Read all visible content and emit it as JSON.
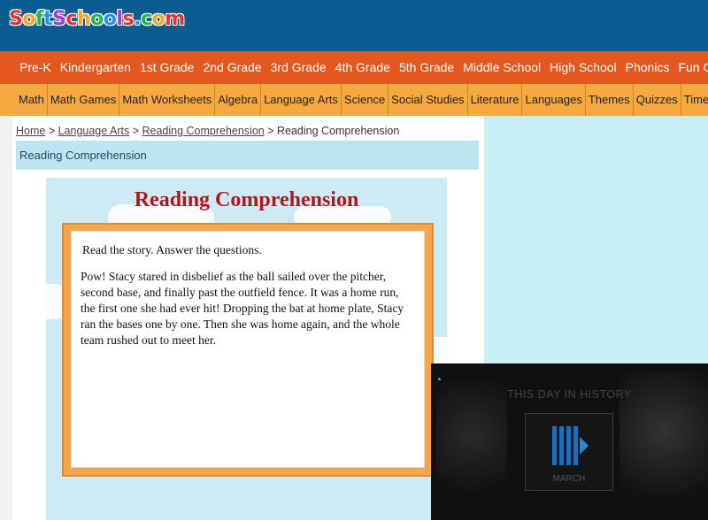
{
  "header": {
    "logo_text": "SoftSchools.com",
    "logo_colors": [
      "#e63232",
      "#f5a623",
      "#2bb24c",
      "#1e90ff",
      "#a23bd6",
      "#e63232",
      "#f5a623",
      "#2bb24c",
      "#1e90ff",
      "#a23bd6",
      "#e63232",
      "#1e90ff",
      "#2bb24c",
      "#f5a623",
      "#e63232"
    ]
  },
  "nav_grades": [
    "Pre-K",
    "Kindergarten",
    "1st Grade",
    "2nd Grade",
    "3rd Grade",
    "4th Grade",
    "5th Grade",
    "Middle School",
    "High School",
    "Phonics",
    "Fun Gam"
  ],
  "nav_subjects": [
    "Math",
    "Math Games",
    "Math Worksheets",
    "Algebra",
    "Language Arts",
    "Science",
    "Social Studies",
    "Literature",
    "Languages",
    "Themes",
    "Quizzes",
    "Timel"
  ],
  "breadcrumb": {
    "home": "Home",
    "sep": " > ",
    "language_arts": "Language Arts",
    "reading": "Reading Comprehension",
    "current": "Reading Comprehension"
  },
  "section_title": "Reading Comprehension",
  "activity": {
    "title": "Reading Comprehension",
    "instructions": "Read the story.  Answer the questions.",
    "story": "Pow!  Stacy stared in disbelief as the ball sailed over the pitcher, second base, and finally past the outfield fence.  It was a home run, the first one she had ever hit!  Dropping the bat at home plate, Stacy ran the bases one by one.  Then she was home again, and the whole team rushed out to meet her."
  },
  "video": {
    "title": "THIS DAY IN HISTORY",
    "month": "MARCH",
    "icons": [
      "history-logo-icon",
      "play-icon"
    ]
  },
  "colors": {
    "header_bg": "#0b5c8f",
    "nav_grades_bg": "#e4571e",
    "nav_subjects_bg": "#f5a93f",
    "title_red": "#b01818",
    "frame_orange": "#f6a64a",
    "sidebar_bg": "#c8f0f4"
  }
}
